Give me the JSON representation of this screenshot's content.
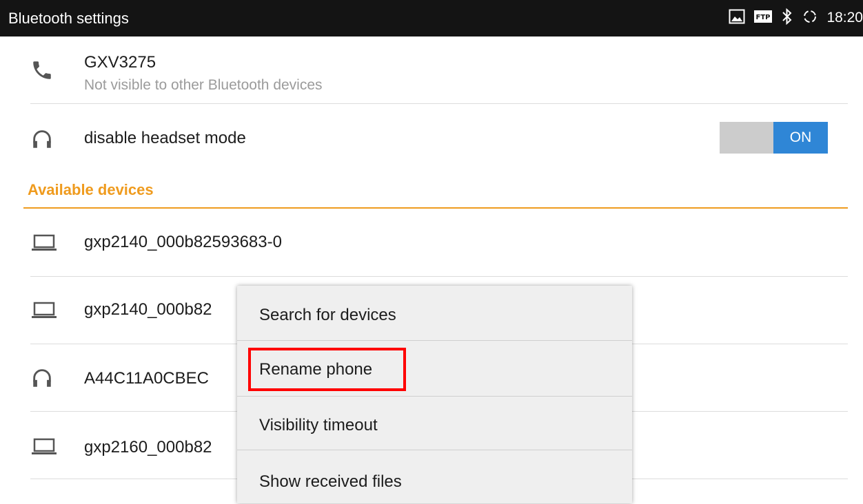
{
  "status_bar": {
    "title": "Bluetooth settings",
    "time": "18:20",
    "icons": [
      "image-icon",
      "ftp-icon",
      "bluetooth-icon",
      "sync-icon"
    ],
    "ftp_label": "FTP"
  },
  "device": {
    "name": "GXV3275",
    "status": "Not visible to other Bluetooth devices",
    "icon": "phone-icon"
  },
  "headset_mode": {
    "label": "disable headset mode",
    "toggle_label": "ON",
    "toggle_color": "#2f86d6",
    "icon": "headset-icon"
  },
  "available_devices": {
    "header": "Available devices",
    "header_color": "#ef9b1e",
    "items": [
      {
        "name": "gxp2140_000b82593683-0",
        "icon": "laptop-icon"
      },
      {
        "name": "gxp2140_000b82",
        "icon": "laptop-icon"
      },
      {
        "name": "A44C11A0CBEC",
        "icon": "headset-icon"
      },
      {
        "name": "gxp2160_000b82",
        "icon": "laptop-icon"
      }
    ]
  },
  "menu": {
    "items": [
      {
        "label": "Search for devices"
      },
      {
        "label": "Rename phone",
        "highlighted": true
      },
      {
        "label": "Visibility timeout"
      },
      {
        "label": "Show received files"
      }
    ],
    "highlight_color": "#ff0000"
  }
}
